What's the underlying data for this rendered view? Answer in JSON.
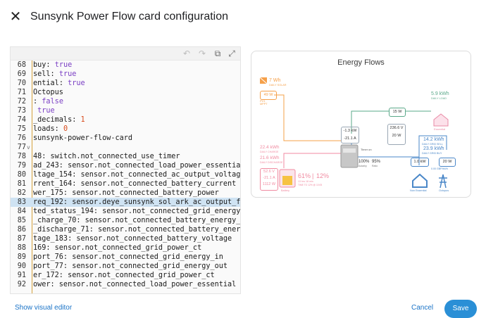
{
  "dialog": {
    "title": "Sunsynk Power Flow card configuration"
  },
  "editor": {
    "lines": [
      {
        "num": "68",
        "key": "buy",
        "sep": ": ",
        "val": "true",
        "cls": "v"
      },
      {
        "num": "69",
        "key": "sell",
        "sep": ": ",
        "val": "true",
        "cls": "v"
      },
      {
        "num": "70",
        "key": "ential",
        "sep": ": ",
        "val": "true",
        "cls": "v"
      },
      {
        "num": "71",
        "key": "Octopus",
        "sep": "",
        "val": "",
        "cls": ""
      },
      {
        "num": "72",
        "key": "",
        "sep": ": ",
        "val": "false",
        "cls": "v"
      },
      {
        "num": "73",
        "key": "",
        "sep": " ",
        "val": "true",
        "cls": "v"
      },
      {
        "num": "74",
        "key": "_decimals",
        "sep": ": ",
        "val": "1",
        "cls": "o"
      },
      {
        "num": "75",
        "key": "loads",
        "sep": ": ",
        "val": "0",
        "cls": "o"
      },
      {
        "num": "76",
        "key": "sunsynk-power-flow-card",
        "sep": "",
        "val": "",
        "cls": ""
      },
      {
        "num": "77",
        "key": "",
        "sep": "",
        "val": "",
        "cls": "",
        "fold": "v"
      },
      {
        "num": "78",
        "key": "48: switch.not_connected_use_timer",
        "sep": "",
        "val": "",
        "cls": ""
      },
      {
        "num": "79",
        "key": "ad_243: sensor.not_connected_load_power_essential",
        "sep": "",
        "val": "",
        "cls": ""
      },
      {
        "num": "80",
        "key": "ltage_154: sensor.not_connected_ac_output_voltage",
        "sep": "",
        "val": "",
        "cls": ""
      },
      {
        "num": "81",
        "key": "rrent_164: sensor.not_connected_battery_current",
        "sep": "",
        "val": "",
        "cls": ""
      },
      {
        "num": "82",
        "key": "wer_175: sensor.not_connected_battery_power",
        "sep": "",
        "val": "",
        "cls": ""
      },
      {
        "num": "83",
        "key": "req_192: sensor.deye_sunsynk_sol_ark_ac_output_fre",
        "sep": "",
        "val": "",
        "cls": "",
        "hl": true
      },
      {
        "num": "84",
        "key": "ted_status_194: sensor.not_connected_grid_energy_c",
        "sep": "",
        "val": "",
        "cls": ""
      },
      {
        "num": "85",
        "key": "_charge_70: sensor.not_connected_battery_energy_in",
        "sep": "",
        "val": "",
        "cls": ""
      },
      {
        "num": "86",
        "key": "_discharge_71: sensor.not_connected_battery_energy",
        "sep": "",
        "val": "",
        "cls": ""
      },
      {
        "num": "87",
        "key": "tage_183: sensor.not_connected_battery_voltage",
        "sep": "",
        "val": "",
        "cls": ""
      },
      {
        "num": "88",
        "key": "169: sensor.not_connected_grid_power_ct",
        "sep": "",
        "val": "",
        "cls": ""
      },
      {
        "num": "89",
        "key": "port_76: sensor.not_connected_grid_energy_in",
        "sep": "",
        "val": "",
        "cls": ""
      },
      {
        "num": "90",
        "key": "port_77: sensor.not_connected_grid_energy_out",
        "sep": "",
        "val": "",
        "cls": ""
      },
      {
        "num": "91",
        "key": "er_172: sensor.not_connected_grid_power_ct",
        "sep": "",
        "val": "",
        "cls": ""
      },
      {
        "num": "92",
        "key": "ower: sensor.not_connected_load_power_essential",
        "sep": "",
        "val": "",
        "cls": ""
      }
    ]
  },
  "preview": {
    "title": "Energy Flows",
    "solar": {
      "daily": "7 Wh",
      "daily_label": "DAILY SOLAR",
      "pv_box": "49 W",
      "pv_label": "PV1",
      "pv_sub": "MPPT"
    },
    "load": {
      "daily": "5.9 kWh",
      "daily_label": "DAILY LOAD",
      "box": "15 W",
      "label": "Essential"
    },
    "inverter": {
      "box1_a": "-1.3 kW",
      "box1_b": "-21.1 A",
      "box2_a": "236.6 V",
      "box2_b": "20 W",
      "percent": "100%",
      "efficiency": "95%",
      "percent_label": "Autarky",
      "eff_label": "Ratio",
      "timer": "Timer on"
    },
    "battery": {
      "charge_daily": "22.4 kWh",
      "charge_label": "DAILY CHARGE",
      "discharge_daily": "21.6 kWh",
      "discharge_label": "DAILY DISCHARGE",
      "v": "52.6 V",
      "a": "-21.1 A",
      "w": "1112 W",
      "soc": "61%",
      "soc2": "12%",
      "soc_sub": "13 hrs 18 min",
      "soc_sub2": "TIME TO 12% @ 10:05",
      "label": "Battery"
    },
    "grid": {
      "sell": "14.2 kWh",
      "sell_label": "DAILY GRID SELL",
      "buy": "23.9 kWh",
      "buy_label": "DAILY GRID BUY",
      "box_left": "1.0 kW",
      "box_right": "20 W",
      "ct_label": "0.00 GBP/kWh",
      "nonessential_label": "Non Essential",
      "octopus_label": "Octopus"
    }
  },
  "footer": {
    "show_visual": "Show visual editor",
    "cancel": "Cancel",
    "save": "Save"
  },
  "colors": {
    "solar": "#f5a04a",
    "battery": "#f08aa0",
    "grid": "#4a87c8",
    "load": "#5aa889",
    "essential": "#e88aa5",
    "accent": "#2a8fd6"
  }
}
